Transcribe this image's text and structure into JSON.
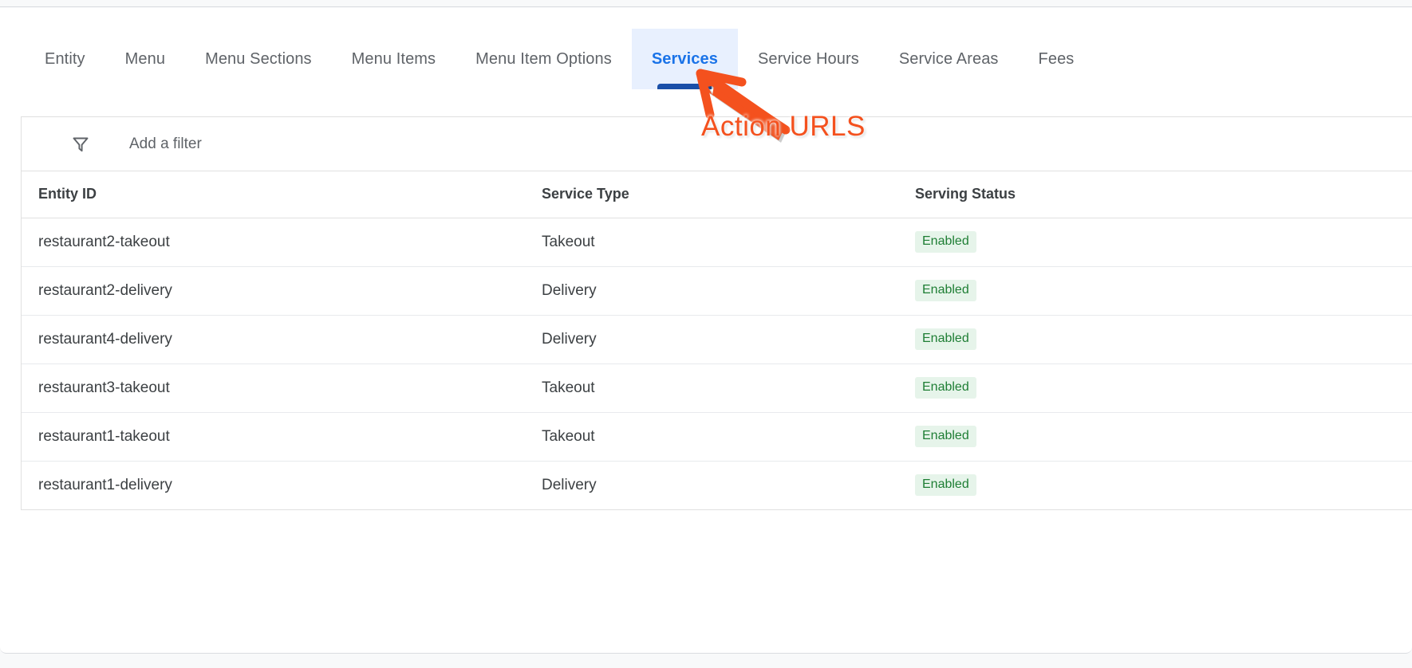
{
  "tabs": [
    {
      "label": "Entity",
      "active": false
    },
    {
      "label": "Menu",
      "active": false
    },
    {
      "label": "Menu Sections",
      "active": false
    },
    {
      "label": "Menu Items",
      "active": false
    },
    {
      "label": "Menu Item Options",
      "active": false
    },
    {
      "label": "Services",
      "active": true
    },
    {
      "label": "Service Hours",
      "active": false
    },
    {
      "label": "Service Areas",
      "active": false
    },
    {
      "label": "Fees",
      "active": false
    }
  ],
  "filter": {
    "icon": "filter-funnel-icon",
    "placeholder": "Add a filter",
    "value": ""
  },
  "table": {
    "columns": [
      "Entity ID",
      "Service Type",
      "Serving Status"
    ],
    "rows": [
      {
        "entity_id": "restaurant2-takeout",
        "service_type": "Takeout",
        "serving_status": "Enabled"
      },
      {
        "entity_id": "restaurant2-delivery",
        "service_type": "Delivery",
        "serving_status": "Enabled"
      },
      {
        "entity_id": "restaurant4-delivery",
        "service_type": "Delivery",
        "serving_status": "Enabled"
      },
      {
        "entity_id": "restaurant3-takeout",
        "service_type": "Takeout",
        "serving_status": "Enabled"
      },
      {
        "entity_id": "restaurant1-takeout",
        "service_type": "Takeout",
        "serving_status": "Enabled"
      },
      {
        "entity_id": "restaurant1-delivery",
        "service_type": "Delivery",
        "serving_status": "Enabled"
      }
    ]
  },
  "annotation": {
    "text": "Action URLS",
    "color": "#f4511e",
    "arrow": "red-arrow-pointing-to-services-tab"
  },
  "colors": {
    "accent": "#1a73e8",
    "active_tab_bg": "#e8f0fe",
    "active_tab_underline": "#1a4fa8",
    "badge_bg": "#e6f4ea",
    "badge_text": "#1e7e34",
    "annotation": "#f4511e"
  }
}
